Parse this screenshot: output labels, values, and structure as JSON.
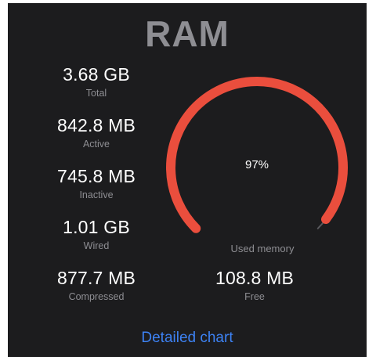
{
  "title": "RAM",
  "stats": {
    "total": {
      "value": "3.68 GB",
      "label": "Total"
    },
    "active": {
      "value": "842.8 MB",
      "label": "Active"
    },
    "inactive": {
      "value": "745.8 MB",
      "label": "Inactive"
    },
    "wired": {
      "value": "1.01 GB",
      "label": "Wired"
    },
    "compressed": {
      "value": "877.7 MB",
      "label": "Compressed"
    },
    "free": {
      "value": "108.8 MB",
      "label": "Free"
    }
  },
  "gauge": {
    "percent_text": "97%",
    "used_fraction": 0.97,
    "label": "Used memory",
    "color": "#ea4e3d",
    "track_color": "#5a5a5e"
  },
  "link": {
    "label": "Detailed chart"
  },
  "colors": {
    "background": "#1c1c1e",
    "accent": "#3d82f4"
  }
}
